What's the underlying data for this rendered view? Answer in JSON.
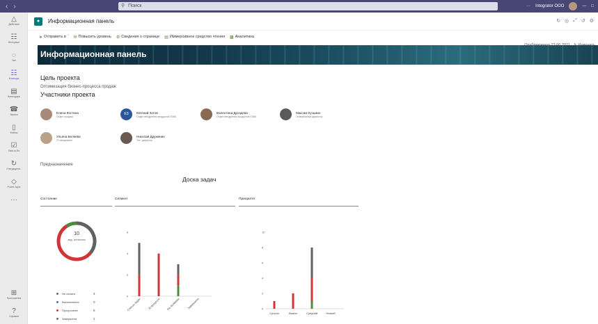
{
  "titlebar": {
    "search_placeholder": "Поиск",
    "org_name": "Integrator OOO"
  },
  "rail": {
    "items": [
      {
        "label": "Действия",
        "icon": "bell-icon"
      },
      {
        "label": "Workplace",
        "icon": "grid-icon"
      },
      {
        "label": "Чат",
        "icon": "chat-icon"
      },
      {
        "label": "Команды",
        "icon": "teams-icon"
      },
      {
        "label": "Календарь",
        "icon": "calendar-icon"
      },
      {
        "label": "Звонки",
        "icon": "phone-icon"
      },
      {
        "label": "Файлы",
        "icon": "file-icon"
      },
      {
        "label": "Task.ru.Ro",
        "icon": "task-icon"
      },
      {
        "label": "Утверждени..",
        "icon": "approval-icon"
      },
      {
        "label": "Power Apps",
        "icon": "power-apps-icon"
      },
      {
        "label": "...",
        "icon": "more-icon"
      }
    ],
    "bottom": [
      {
        "label": "Приложения",
        "icon": "apps-icon"
      },
      {
        "label": "Справка",
        "icon": "help-icon"
      }
    ]
  },
  "app": {
    "title": "Информационная панель"
  },
  "cmdbar": {
    "items": [
      "Отправить в",
      "Повысить уровень",
      "Сведения о странице",
      "Иммерсивное средство чтения",
      "Аналитика"
    ],
    "published": "Опубликовано 23.06.2021",
    "edit": "Изменить"
  },
  "hero": {
    "title": "Информационная панель"
  },
  "goal": {
    "heading": "Цель проекта",
    "text": "Оптимизация бизнес-процесса продаж"
  },
  "team": {
    "heading": "Участники проекта",
    "people": [
      {
        "name": "Елена Костина",
        "role": "Отдел продаж",
        "color": "#a88a78"
      },
      {
        "name": "Евгений Зотов",
        "role": "Отдел внедрения продуктов O365",
        "initials": "ЕЗ",
        "color": "#2b579a"
      },
      {
        "name": "Валентина Дроздова",
        "role": "Отдел внедрения продуктов O365",
        "color": "#8a6a55"
      },
      {
        "name": "Максим Кузьмин",
        "role": "Генеральный директор",
        "color": "#5a5a5a"
      },
      {
        "name": "Ульяна Беляева",
        "role": "IT-специалист",
        "color": "#b9a28a"
      },
      {
        "name": "Николай Дружинин",
        "role": "Тех. директор",
        "color": "#6a5a50"
      }
    ]
  },
  "purpose": "Предназначение",
  "board": {
    "title": "Доска задач",
    "sections": [
      "Состояние",
      "Сегмент",
      "Приоритет"
    ],
    "donut": {
      "count": "10",
      "label": "зад. осталось"
    },
    "legend": [
      {
        "label": "Не начата",
        "value": "4",
        "color": "#5b6b73"
      },
      {
        "label": "Выполняется",
        "value": "0",
        "color": "#4b6fa8"
      },
      {
        "label": "Просрочена",
        "value": "6",
        "color": "#d13438"
      },
      {
        "label": "Завершена",
        "value": "1",
        "color": "#4c8a3d"
      }
    ]
  },
  "colors": {
    "not_started": "#616161",
    "late": "#d13438",
    "done": "#4c8a3d"
  },
  "chart_data": [
    {
      "type": "pie",
      "title": "Состояние",
      "categories": [
        "Не начата",
        "Выполняется",
        "Просрочена",
        "Завершена"
      ],
      "values": [
        4,
        0,
        6,
        1
      ]
    },
    {
      "type": "bar",
      "title": "Сегмент",
      "categories": [
        "Список задач",
        "В процессе",
        "На проверке",
        "Завершено"
      ],
      "series": [
        {
          "name": "Завершена",
          "values": [
            0,
            0,
            1,
            0
          ]
        },
        {
          "name": "Просрочена",
          "values": [
            2,
            4,
            1,
            0
          ]
        },
        {
          "name": "Не начата",
          "values": [
            3,
            0,
            1,
            0
          ]
        }
      ],
      "ylim": [
        0,
        6
      ],
      "yticks": [
        0,
        2,
        4,
        6
      ]
    },
    {
      "type": "bar",
      "title": "Приоритет",
      "categories": [
        "Срочно",
        "Важно",
        "Средний",
        "Низкий"
      ],
      "series": [
        {
          "name": "Завершена",
          "values": [
            0,
            0,
            1,
            0
          ]
        },
        {
          "name": "Просрочена",
          "values": [
            1,
            2,
            3,
            0
          ]
        },
        {
          "name": "Не начата",
          "values": [
            0,
            0,
            4,
            0
          ]
        }
      ],
      "ylim": [
        0,
        10
      ],
      "yticks": [
        0,
        2,
        4,
        6,
        8,
        10
      ]
    }
  ]
}
